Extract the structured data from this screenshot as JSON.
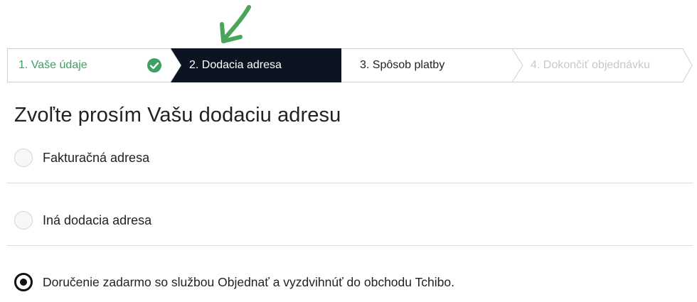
{
  "annotation": {
    "arrow_color": "#4aa45a",
    "icon": "arrow-annotation-icon"
  },
  "stepper": {
    "steps": [
      {
        "label": "1. Vaše údaje",
        "state": "completed",
        "color": "#3ea066",
        "icon": "check-circle-icon"
      },
      {
        "label": "2. Dodacia adresa",
        "state": "active",
        "color": "#ffffff",
        "background": "#0d1421"
      },
      {
        "label": "3. Spôsob platby",
        "state": "upcoming",
        "color": "#222222"
      },
      {
        "label": "4. Dokončiť objednávku",
        "state": "disabled",
        "color": "#c8c8c8"
      }
    ]
  },
  "page": {
    "title": "Zvoľte prosím Vašu dodaciu adresu"
  },
  "options": [
    {
      "label": "Fakturačná adresa",
      "checked": false
    },
    {
      "label": "Iná dodacia adresa",
      "checked": false
    },
    {
      "label": "Doručenie zadarmo so službou Objednať a vyzdvihnúť do obchodu Tchibo.",
      "checked": true
    }
  ]
}
